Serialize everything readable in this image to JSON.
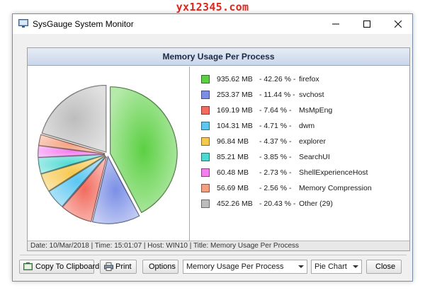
{
  "watermark": "yx12345.com",
  "window": {
    "title": "SysGauge System Monitor"
  },
  "panel": {
    "header": "Memory Usage Per Process",
    "status": "Date: 10/Mar/2018 | Time: 15:01:07 | Host: WIN10 | Title: Memory Usage Per Process"
  },
  "chart_data": {
    "type": "pie",
    "title": "Memory Usage Per Process",
    "slices": [
      {
        "name": "firefox",
        "mb": "935.62 MB",
        "pct_label": "42.26 %",
        "value": 42.26,
        "color": "#5cd043"
      },
      {
        "name": "svchost",
        "mb": "253.37 MB",
        "pct_label": "11.44 %",
        "value": 11.44,
        "color": "#7b8fe6"
      },
      {
        "name": "MsMpEng",
        "mb": "169.19 MB",
        "pct_label": "7.64 %",
        "value": 7.64,
        "color": "#f26b5e"
      },
      {
        "name": "dwm",
        "mb": "104.31 MB",
        "pct_label": "4.71 %",
        "value": 4.71,
        "color": "#5bc7f2"
      },
      {
        "name": "explorer",
        "mb": "96.84 MB",
        "pct_label": "4.37 %",
        "value": 4.37,
        "color": "#f6c84d"
      },
      {
        "name": "SearchUI",
        "mb": "85.21 MB",
        "pct_label": "3.85 %",
        "value": 3.85,
        "color": "#4cd9d2"
      },
      {
        "name": "ShellExperienceHost",
        "mb": "60.48 MB",
        "pct_label": "2.73 %",
        "value": 2.73,
        "color": "#f57df0"
      },
      {
        "name": "Memory Compression",
        "mb": "56.69 MB",
        "pct_label": "2.56 %",
        "value": 2.56,
        "color": "#f4a07f"
      },
      {
        "name": "Other (29)",
        "mb": "452.26 MB",
        "pct_label": "20.43 %",
        "value": 20.43,
        "color": "#bdbdbd"
      }
    ],
    "separator": "-",
    "legend_placement": "right"
  },
  "toolbar": {
    "copy_label": "Copy To Clipboard",
    "print_label": "Print",
    "options_label": "Options",
    "chart_select_value": "Memory Usage Per Process",
    "type_select_value": "Pie Chart",
    "close_label": "Close"
  }
}
